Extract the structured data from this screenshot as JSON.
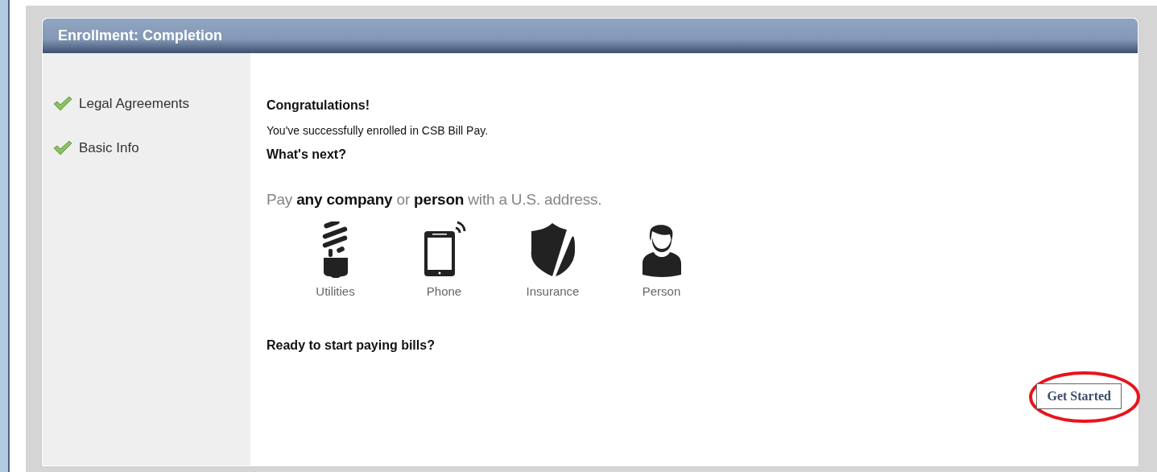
{
  "panel": {
    "title": "Enrollment: Completion"
  },
  "steps": [
    {
      "label": "Legal Agreements",
      "completed": true
    },
    {
      "label": "Basic Info",
      "completed": true
    }
  ],
  "content": {
    "heading": "Congratulations!",
    "message": "You've successfully enrolled in CSB Bill Pay.",
    "subheading": "What's next?",
    "tagline": "Pay **any company** or **person** with a U.S. address.",
    "payees": [
      {
        "kind": "utilities",
        "label": "Utilities"
      },
      {
        "kind": "phone",
        "label": "Phone"
      },
      {
        "kind": "insurance",
        "label": "Insurance"
      },
      {
        "kind": "person",
        "label": "Person"
      }
    ],
    "prompt": "Ready to start paying bills?",
    "button": {
      "label": "Get Started",
      "highlighted": true
    }
  }
}
